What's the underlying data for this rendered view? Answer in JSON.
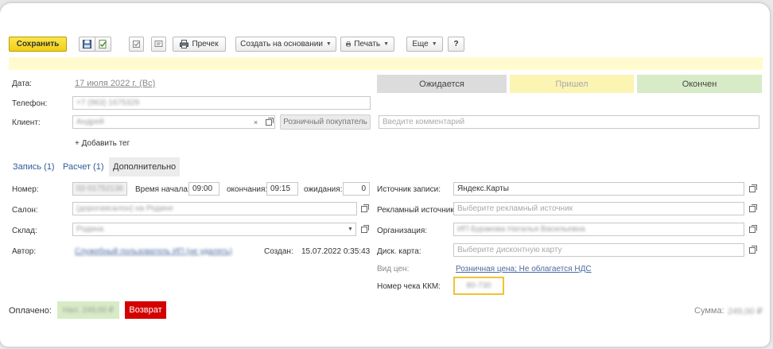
{
  "toolbar": {
    "save_label": "Сохранить",
    "precheck_label": "Пречек",
    "create_based_label": "Создать на основании",
    "print_label": "Печать",
    "more_label": "Еще",
    "help_label": "?"
  },
  "status_bar": {
    "waiting": "Ожидается",
    "arrived": "Пришел",
    "finished": "Окончен",
    "colors": {
      "waiting": "#dcdcdc",
      "arrived": "#fbf4b3",
      "finished": "#d7ebc7",
      "notice": "#fffbcf"
    }
  },
  "header": {
    "date_label": "Дата:",
    "date_value": "17 июля 2022 г. (Вс)",
    "phone_label": "Телефон:",
    "phone_value": "+7 (963) 1675329",
    "client_label": "Клиент:",
    "client_value": "Андрей",
    "retail_buyer_label": "Розничный покупатель",
    "comment_placeholder": "Введите комментарий",
    "add_tag_label": "+ Добавить тег"
  },
  "tabs": [
    {
      "label": "Запись (1)"
    },
    {
      "label": "Расчет (1)"
    },
    {
      "label": "Дополнительно"
    }
  ],
  "left_form": {
    "number_label": "Номер:",
    "number_value": "02-01752136",
    "start_time_label": "Время начала:",
    "start_time_value": "09:00",
    "end_label": "окончания:",
    "end_value": "09:15",
    "wait_label": "ожидания:",
    "wait_value": "0",
    "salon_label": "Салон:",
    "salon_value": "(дорогаясалон) на Родине",
    "warehouse_label": "Склад:",
    "warehouse_value": "Родина",
    "author_label": "Автор:",
    "author_value": "Служебный пользователь ИП (не удалять)",
    "created_label": "Создан:",
    "created_value": "15.07.2022 0:35:43"
  },
  "right_form": {
    "source_label": "Источник записи:",
    "source_value": "Яндекс.Карты",
    "ad_source_label": "Рекламный источник:",
    "ad_source_placeholder": "Выберите рекламный источник",
    "org_label": "Организация:",
    "org_value": "ИП Буракова Наталья Васильевна",
    "discount_label": "Диск. карта:",
    "discount_placeholder": "Выберите дисконтную карту",
    "price_type_label": "Вид цен:",
    "price_type_value": "Розничная цена; Не облагается НДС",
    "receipt_label": "Номер чека ККМ:",
    "receipt_value": "80-730"
  },
  "footer": {
    "paid_label": "Оплачено:",
    "paid_value": "Нал. 249,00 ₽",
    "refund_label": "Возврат",
    "sum_label": "Сумма:",
    "sum_value": "249,00 ₽"
  }
}
